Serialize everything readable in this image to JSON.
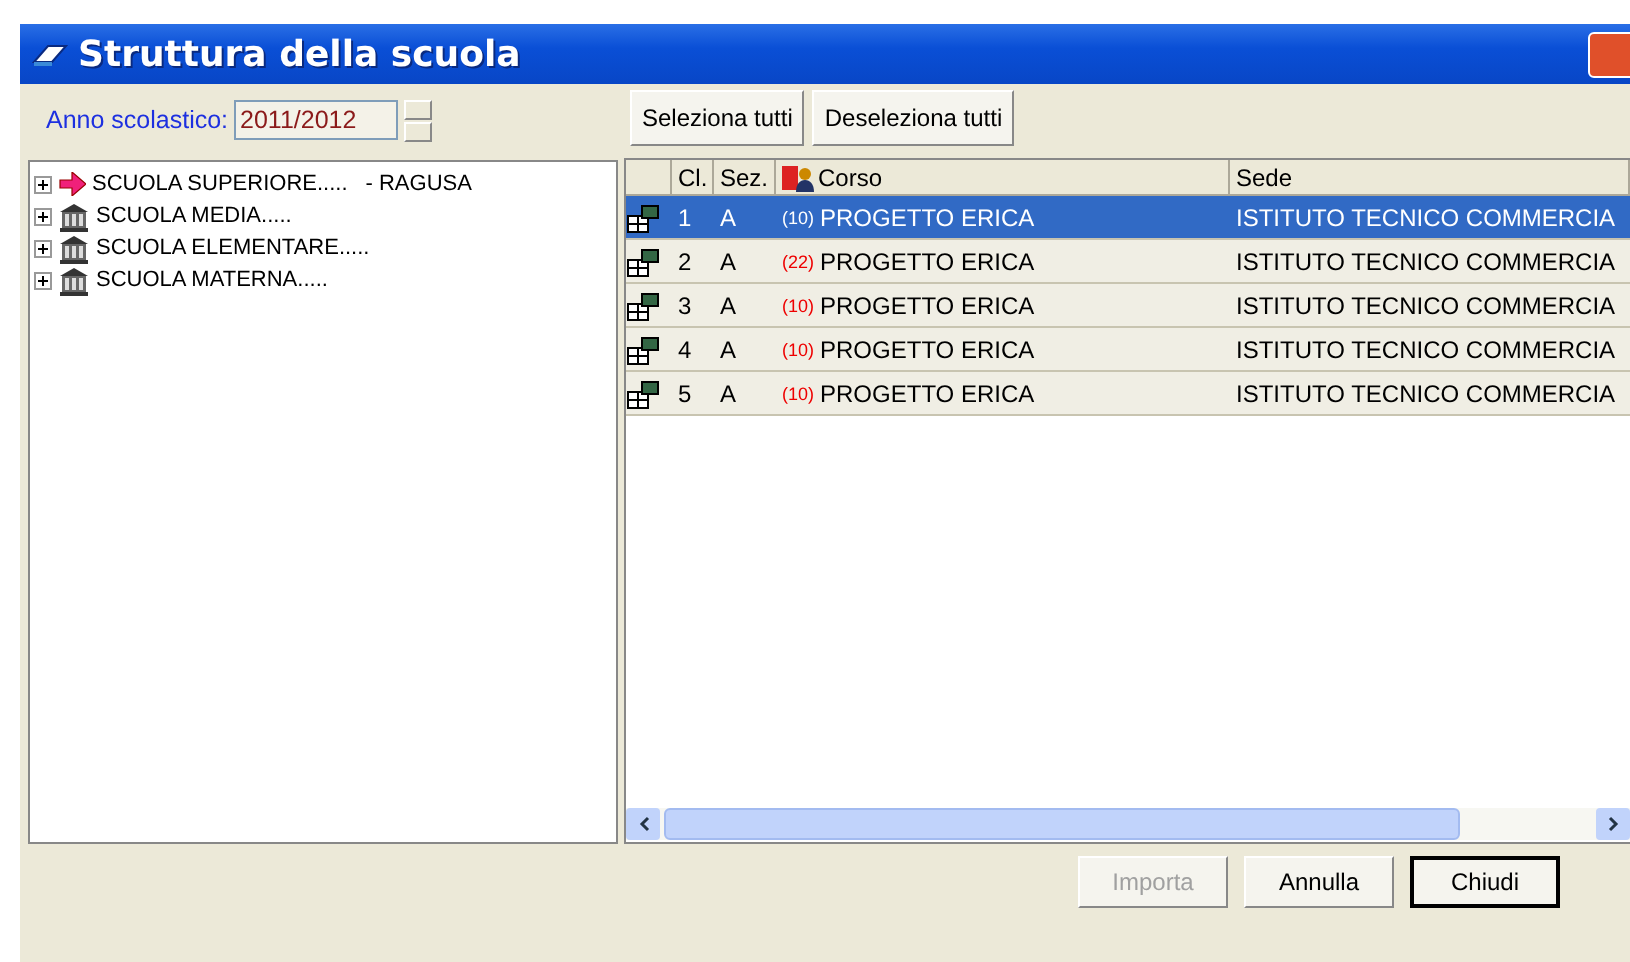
{
  "window": {
    "title": "Struttura della scuola"
  },
  "year": {
    "label": "Anno scolastico:",
    "value": "2011/2012"
  },
  "tree": [
    {
      "label": "SCUOLA SUPERIORE.....",
      "suffix": "- RAGUSA",
      "kind": "arrow",
      "expanded": false
    },
    {
      "label": "SCUOLA MEDIA.....",
      "kind": "building",
      "expanded": false
    },
    {
      "label": "SCUOLA ELEMENTARE.....",
      "kind": "building",
      "expanded": false
    },
    {
      "label": "SCUOLA MATERNA.....",
      "kind": "building",
      "expanded": false
    }
  ],
  "toolbar": [
    "Seleziona tutti",
    "Deseleziona tutti"
  ],
  "table": {
    "columns": [
      "Cl.",
      "Sez.",
      "Corso",
      "Sede"
    ],
    "rows": [
      {
        "cl": "1",
        "sez": "A",
        "count": "(10)",
        "corso": "PROGETTO ERICA",
        "sede": "ISTITUTO TECNICO COMMERCIA",
        "selected": true
      },
      {
        "cl": "2",
        "sez": "A",
        "count": "(22)",
        "corso": "PROGETTO ERICA",
        "sede": "ISTITUTO TECNICO COMMERCIA",
        "selected": false
      },
      {
        "cl": "3",
        "sez": "A",
        "count": "(10)",
        "corso": "PROGETTO ERICA",
        "sede": "ISTITUTO TECNICO COMMERCIA",
        "selected": false
      },
      {
        "cl": "4",
        "sez": "A",
        "count": "(10)",
        "corso": "PROGETTO ERICA",
        "sede": "ISTITUTO TECNICO COMMERCIA",
        "selected": false
      },
      {
        "cl": "5",
        "sez": "A",
        "count": "(10)",
        "corso": "PROGETTO ERICA",
        "sede": "ISTITUTO TECNICO COMMERCIA",
        "selected": false
      }
    ]
  },
  "buttons": [
    {
      "label": "Importa",
      "disabled": true,
      "default": false
    },
    {
      "label": "Annulla",
      "disabled": false,
      "default": false
    },
    {
      "label": "Chiudi",
      "disabled": false,
      "default": true
    }
  ]
}
